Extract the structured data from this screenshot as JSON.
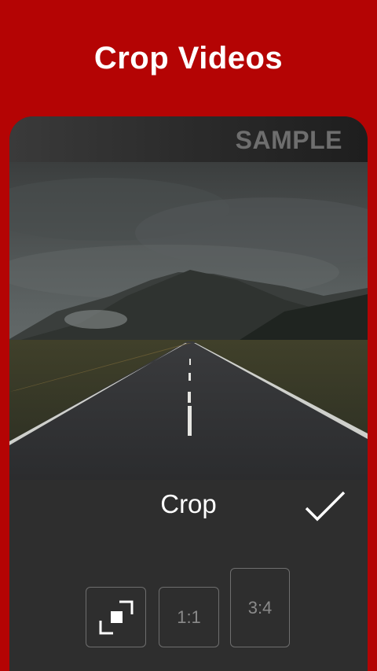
{
  "headline": "Crop Videos",
  "watermark": "SAMPLE",
  "editor": {
    "title": "Crop",
    "confirm_icon": "check-icon",
    "aspect_options": [
      {
        "id": "free",
        "icon": "free-crop-icon"
      },
      {
        "id": "1:1",
        "label": "1:1"
      },
      {
        "id": "3:4",
        "label": "3:4"
      }
    ]
  },
  "colors": {
    "background": "#b40404",
    "panel": "#2e2e2e",
    "text": "#ffffff",
    "muted": "#8a8a8a"
  }
}
